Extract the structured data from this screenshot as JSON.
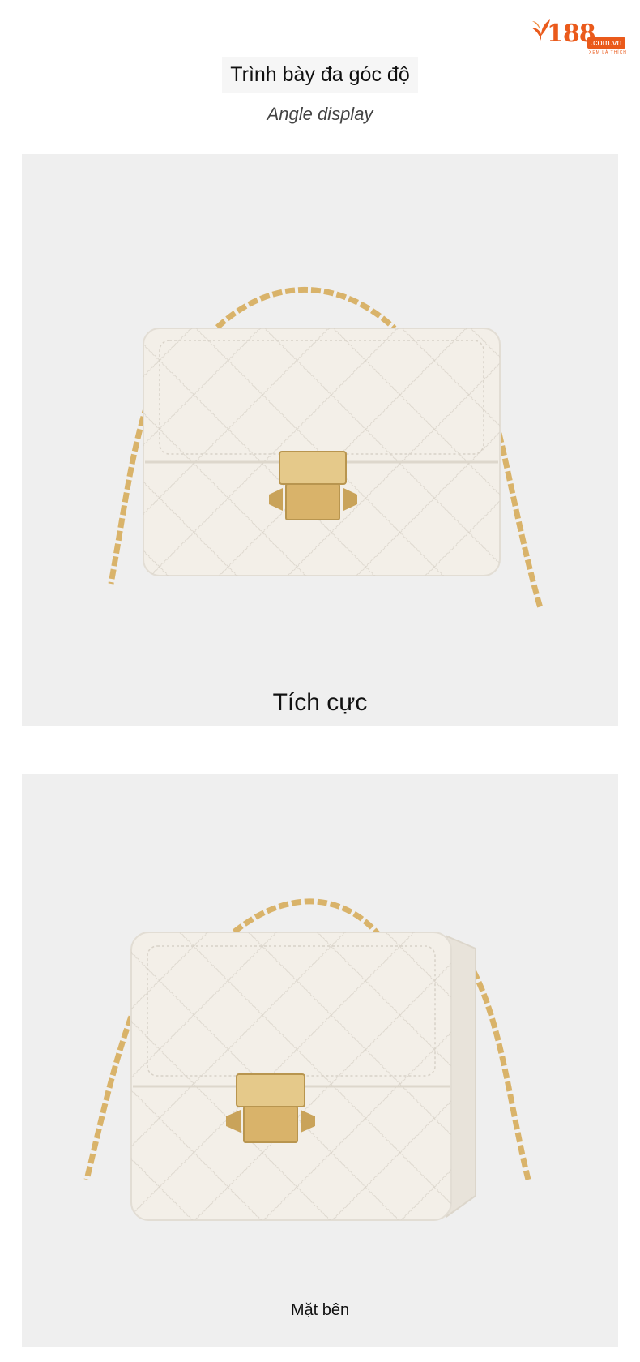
{
  "brand": {
    "number": "188",
    "domain": ".com.vn",
    "tagline": "XEM LÀ THÍCH"
  },
  "header": {
    "title": "Trình bày đa góc độ",
    "subtitle": "Angle display"
  },
  "panels": [
    {
      "caption": "Tích cực",
      "image": "front-view-handbag"
    },
    {
      "caption": "Mặt bên",
      "image": "side-view-handbag"
    }
  ],
  "colors": {
    "brand": "#ea5a1b",
    "panel_bg": "#efefef",
    "bag": "#f3efe8",
    "gold": "#d9b36a"
  }
}
